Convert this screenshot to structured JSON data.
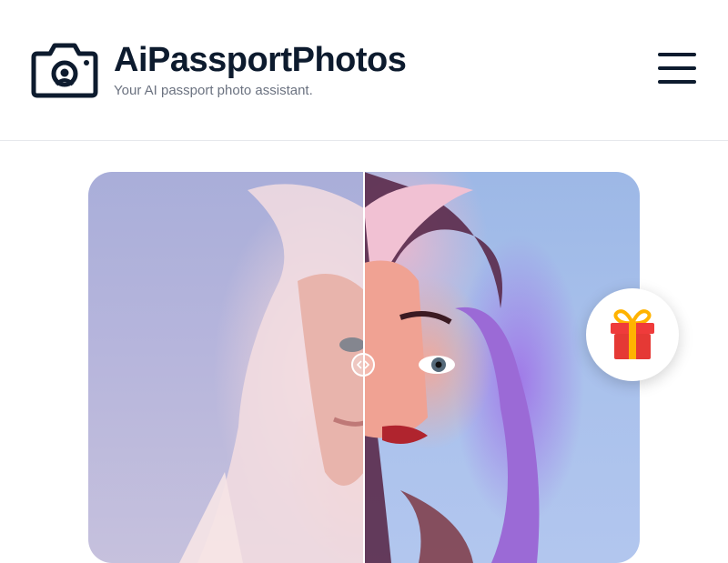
{
  "header": {
    "brand_title": "AiPassportPhotos",
    "brand_tagline": "Your AI passport photo assistant.",
    "logo_icon": "camera-icon",
    "menu_icon": "hamburger-menu-icon"
  },
  "main": {
    "comparison": {
      "before_image": "original-portrait-photo",
      "after_image": "ai-painted-portrait",
      "handle_icon": "left-right-arrows-icon"
    },
    "gift_icon": "gift-icon"
  },
  "colors": {
    "brand_dark": "#0d1b2e",
    "tagline_gray": "#6b7280",
    "gift_red": "#e53935",
    "gift_ribbon": "#ffb300"
  }
}
